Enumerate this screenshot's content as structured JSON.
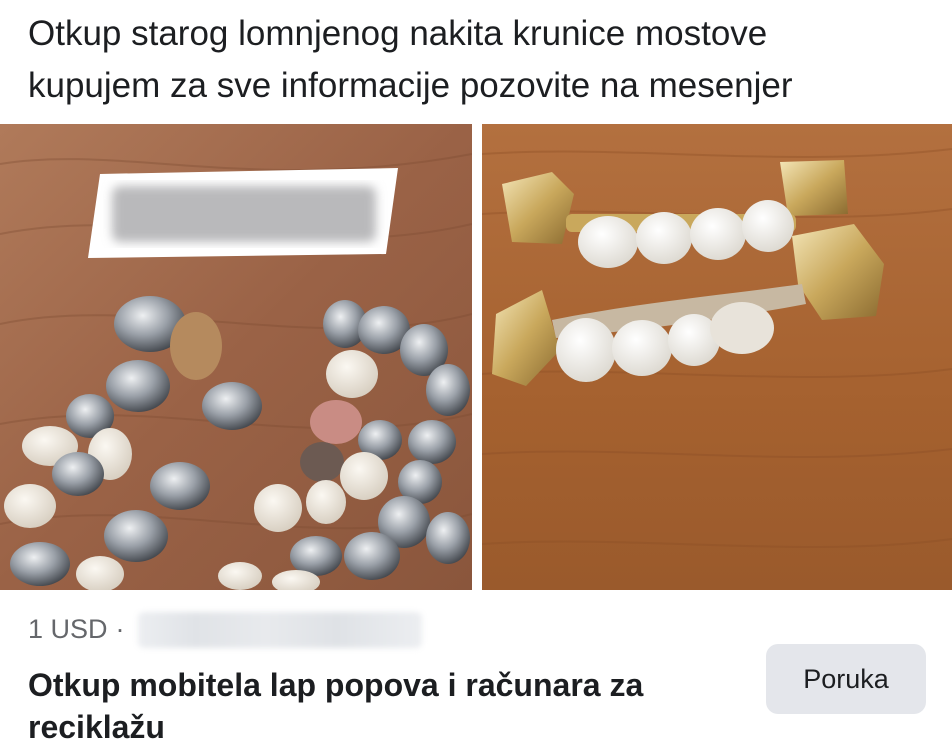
{
  "post": {
    "text_line1": "Otkup starog lomnjenog nakita krunice mostove",
    "text_line2": "kupujem za sve informacije pozovite na mesenjer"
  },
  "photos": [
    {
      "name": "dental-crowns-photo"
    },
    {
      "name": "dental-bridges-photo"
    }
  ],
  "listing": {
    "price": "1 USD",
    "separator": "·",
    "title": "Otkup mobitela lap popova i računara za reciklažu",
    "message_button_label": "Poruka"
  },
  "colors": {
    "text_primary": "#1c1e21",
    "text_secondary": "#65676b",
    "button_bg": "#e4e6eb",
    "wood_left": "#a0694a",
    "wood_right": "#a8653a"
  }
}
